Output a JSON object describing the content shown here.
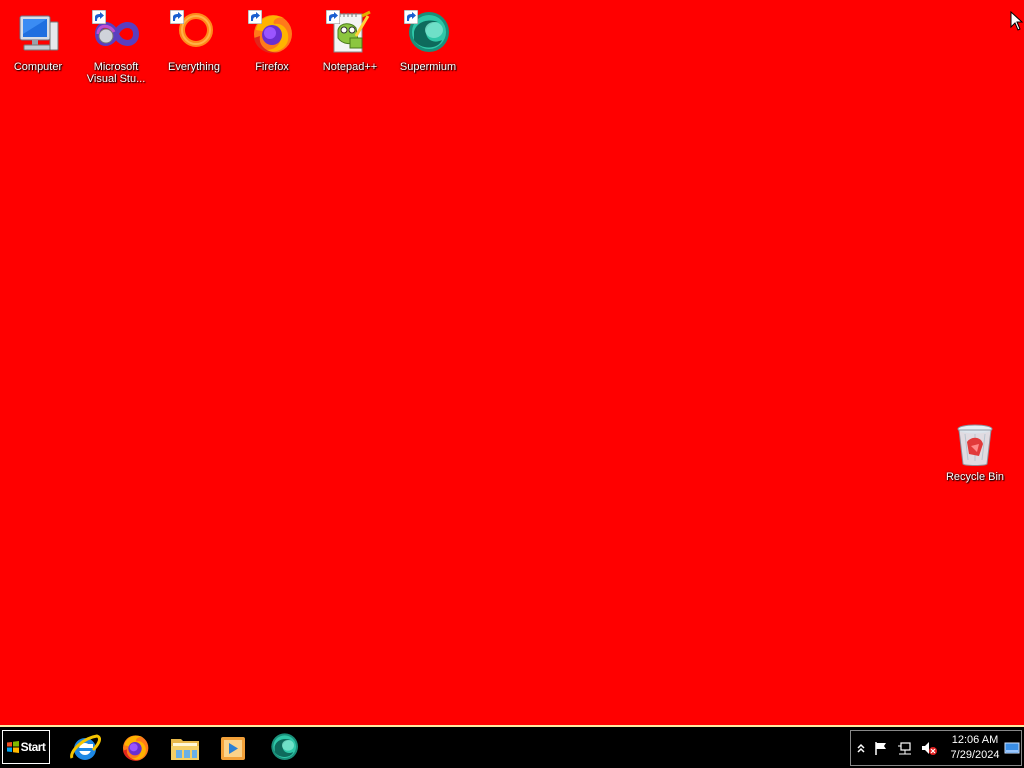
{
  "desktop": {
    "background_color": "#ff0000",
    "icons": [
      {
        "label": "Computer",
        "icon": "computer-icon"
      },
      {
        "label": "Microsoft\nVisual Stu...",
        "icon": "visual-studio-icon"
      },
      {
        "label": "Everything",
        "icon": "everything-icon"
      },
      {
        "label": "Firefox",
        "icon": "firefox-icon"
      },
      {
        "label": "Notepad++",
        "icon": "notepad-plus-plus-icon"
      },
      {
        "label": "Supermium",
        "icon": "supermium-icon"
      },
      {
        "label": "Recycle Bin",
        "icon": "recycle-bin-icon"
      }
    ]
  },
  "taskbar": {
    "start_label": "Start",
    "pinned_apps": [
      {
        "name": "Internet Explorer",
        "icon": "internet-explorer-icon"
      },
      {
        "name": "Firefox",
        "icon": "firefox-icon"
      },
      {
        "name": "File Explorer",
        "icon": "file-explorer-icon"
      },
      {
        "name": "Windows Media Player",
        "icon": "media-player-icon"
      },
      {
        "name": "Supermium",
        "icon": "supermium-icon"
      }
    ],
    "tray": {
      "icons": [
        "show-hidden-icons-icon",
        "action-center-flag-icon",
        "network-icon",
        "volume-muted-icon",
        "show-desktop-icon"
      ],
      "time": "12:06 AM",
      "date": "7/29/2024"
    }
  }
}
